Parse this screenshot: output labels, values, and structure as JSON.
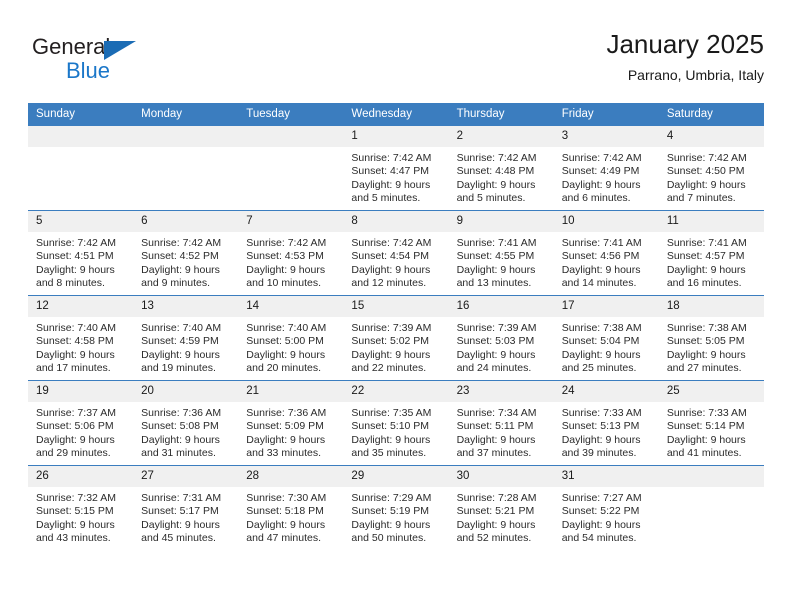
{
  "brand": {
    "name_part1": "General",
    "name_part2": "Blue",
    "triangle_color": "#1b6cb5",
    "blue_color": "#1b77c9"
  },
  "header": {
    "title": "January 2025",
    "subtitle": "Parrano, Umbria, Italy"
  },
  "theme": {
    "header_bg": "#3b7dbf",
    "daynum_bg": "#f0f0f0",
    "border": "#3b7dbf"
  },
  "weekdays": [
    "Sunday",
    "Monday",
    "Tuesday",
    "Wednesday",
    "Thursday",
    "Friday",
    "Saturday"
  ],
  "weeks": [
    [
      {
        "day": "",
        "sunrise": "",
        "sunset": "",
        "daylight1": "",
        "daylight2": ""
      },
      {
        "day": "",
        "sunrise": "",
        "sunset": "",
        "daylight1": "",
        "daylight2": ""
      },
      {
        "day": "",
        "sunrise": "",
        "sunset": "",
        "daylight1": "",
        "daylight2": ""
      },
      {
        "day": "1",
        "sunrise": "Sunrise: 7:42 AM",
        "sunset": "Sunset: 4:47 PM",
        "daylight1": "Daylight: 9 hours",
        "daylight2": "and 5 minutes."
      },
      {
        "day": "2",
        "sunrise": "Sunrise: 7:42 AM",
        "sunset": "Sunset: 4:48 PM",
        "daylight1": "Daylight: 9 hours",
        "daylight2": "and 5 minutes."
      },
      {
        "day": "3",
        "sunrise": "Sunrise: 7:42 AM",
        "sunset": "Sunset: 4:49 PM",
        "daylight1": "Daylight: 9 hours",
        "daylight2": "and 6 minutes."
      },
      {
        "day": "4",
        "sunrise": "Sunrise: 7:42 AM",
        "sunset": "Sunset: 4:50 PM",
        "daylight1": "Daylight: 9 hours",
        "daylight2": "and 7 minutes."
      }
    ],
    [
      {
        "day": "5",
        "sunrise": "Sunrise: 7:42 AM",
        "sunset": "Sunset: 4:51 PM",
        "daylight1": "Daylight: 9 hours",
        "daylight2": "and 8 minutes."
      },
      {
        "day": "6",
        "sunrise": "Sunrise: 7:42 AM",
        "sunset": "Sunset: 4:52 PM",
        "daylight1": "Daylight: 9 hours",
        "daylight2": "and 9 minutes."
      },
      {
        "day": "7",
        "sunrise": "Sunrise: 7:42 AM",
        "sunset": "Sunset: 4:53 PM",
        "daylight1": "Daylight: 9 hours",
        "daylight2": "and 10 minutes."
      },
      {
        "day": "8",
        "sunrise": "Sunrise: 7:42 AM",
        "sunset": "Sunset: 4:54 PM",
        "daylight1": "Daylight: 9 hours",
        "daylight2": "and 12 minutes."
      },
      {
        "day": "9",
        "sunrise": "Sunrise: 7:41 AM",
        "sunset": "Sunset: 4:55 PM",
        "daylight1": "Daylight: 9 hours",
        "daylight2": "and 13 minutes."
      },
      {
        "day": "10",
        "sunrise": "Sunrise: 7:41 AM",
        "sunset": "Sunset: 4:56 PM",
        "daylight1": "Daylight: 9 hours",
        "daylight2": "and 14 minutes."
      },
      {
        "day": "11",
        "sunrise": "Sunrise: 7:41 AM",
        "sunset": "Sunset: 4:57 PM",
        "daylight1": "Daylight: 9 hours",
        "daylight2": "and 16 minutes."
      }
    ],
    [
      {
        "day": "12",
        "sunrise": "Sunrise: 7:40 AM",
        "sunset": "Sunset: 4:58 PM",
        "daylight1": "Daylight: 9 hours",
        "daylight2": "and 17 minutes."
      },
      {
        "day": "13",
        "sunrise": "Sunrise: 7:40 AM",
        "sunset": "Sunset: 4:59 PM",
        "daylight1": "Daylight: 9 hours",
        "daylight2": "and 19 minutes."
      },
      {
        "day": "14",
        "sunrise": "Sunrise: 7:40 AM",
        "sunset": "Sunset: 5:00 PM",
        "daylight1": "Daylight: 9 hours",
        "daylight2": "and 20 minutes."
      },
      {
        "day": "15",
        "sunrise": "Sunrise: 7:39 AM",
        "sunset": "Sunset: 5:02 PM",
        "daylight1": "Daylight: 9 hours",
        "daylight2": "and 22 minutes."
      },
      {
        "day": "16",
        "sunrise": "Sunrise: 7:39 AM",
        "sunset": "Sunset: 5:03 PM",
        "daylight1": "Daylight: 9 hours",
        "daylight2": "and 24 minutes."
      },
      {
        "day": "17",
        "sunrise": "Sunrise: 7:38 AM",
        "sunset": "Sunset: 5:04 PM",
        "daylight1": "Daylight: 9 hours",
        "daylight2": "and 25 minutes."
      },
      {
        "day": "18",
        "sunrise": "Sunrise: 7:38 AM",
        "sunset": "Sunset: 5:05 PM",
        "daylight1": "Daylight: 9 hours",
        "daylight2": "and 27 minutes."
      }
    ],
    [
      {
        "day": "19",
        "sunrise": "Sunrise: 7:37 AM",
        "sunset": "Sunset: 5:06 PM",
        "daylight1": "Daylight: 9 hours",
        "daylight2": "and 29 minutes."
      },
      {
        "day": "20",
        "sunrise": "Sunrise: 7:36 AM",
        "sunset": "Sunset: 5:08 PM",
        "daylight1": "Daylight: 9 hours",
        "daylight2": "and 31 minutes."
      },
      {
        "day": "21",
        "sunrise": "Sunrise: 7:36 AM",
        "sunset": "Sunset: 5:09 PM",
        "daylight1": "Daylight: 9 hours",
        "daylight2": "and 33 minutes."
      },
      {
        "day": "22",
        "sunrise": "Sunrise: 7:35 AM",
        "sunset": "Sunset: 5:10 PM",
        "daylight1": "Daylight: 9 hours",
        "daylight2": "and 35 minutes."
      },
      {
        "day": "23",
        "sunrise": "Sunrise: 7:34 AM",
        "sunset": "Sunset: 5:11 PM",
        "daylight1": "Daylight: 9 hours",
        "daylight2": "and 37 minutes."
      },
      {
        "day": "24",
        "sunrise": "Sunrise: 7:33 AM",
        "sunset": "Sunset: 5:13 PM",
        "daylight1": "Daylight: 9 hours",
        "daylight2": "and 39 minutes."
      },
      {
        "day": "25",
        "sunrise": "Sunrise: 7:33 AM",
        "sunset": "Sunset: 5:14 PM",
        "daylight1": "Daylight: 9 hours",
        "daylight2": "and 41 minutes."
      }
    ],
    [
      {
        "day": "26",
        "sunrise": "Sunrise: 7:32 AM",
        "sunset": "Sunset: 5:15 PM",
        "daylight1": "Daylight: 9 hours",
        "daylight2": "and 43 minutes."
      },
      {
        "day": "27",
        "sunrise": "Sunrise: 7:31 AM",
        "sunset": "Sunset: 5:17 PM",
        "daylight1": "Daylight: 9 hours",
        "daylight2": "and 45 minutes."
      },
      {
        "day": "28",
        "sunrise": "Sunrise: 7:30 AM",
        "sunset": "Sunset: 5:18 PM",
        "daylight1": "Daylight: 9 hours",
        "daylight2": "and 47 minutes."
      },
      {
        "day": "29",
        "sunrise": "Sunrise: 7:29 AM",
        "sunset": "Sunset: 5:19 PM",
        "daylight1": "Daylight: 9 hours",
        "daylight2": "and 50 minutes."
      },
      {
        "day": "30",
        "sunrise": "Sunrise: 7:28 AM",
        "sunset": "Sunset: 5:21 PM",
        "daylight1": "Daylight: 9 hours",
        "daylight2": "and 52 minutes."
      },
      {
        "day": "31",
        "sunrise": "Sunrise: 7:27 AM",
        "sunset": "Sunset: 5:22 PM",
        "daylight1": "Daylight: 9 hours",
        "daylight2": "and 54 minutes."
      },
      {
        "day": "",
        "sunrise": "",
        "sunset": "",
        "daylight1": "",
        "daylight2": ""
      }
    ]
  ]
}
